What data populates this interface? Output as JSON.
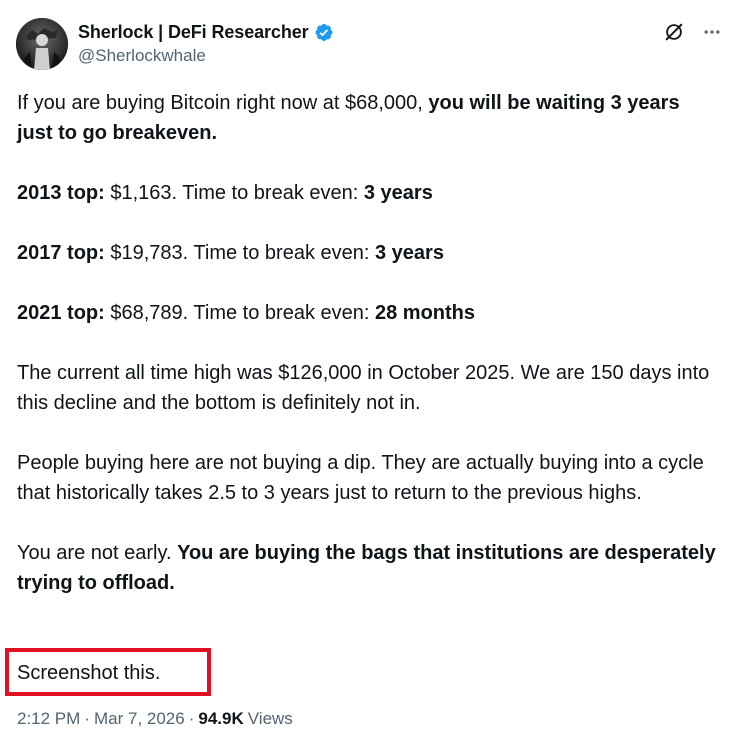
{
  "author": {
    "display_name": "Sherlock | DeFi Researcher",
    "handle": "@Sherlockwhale",
    "verified_color": "#1d9bf0"
  },
  "paragraphs": [
    {
      "runs": [
        {
          "text": "If you are buying Bitcoin right now at $68,000, ",
          "bold": false
        },
        {
          "text": "you will be waiting 3 years just to go breakeven.",
          "bold": true
        }
      ]
    },
    {
      "runs": [
        {
          "text": "2013 top:",
          "bold": true
        },
        {
          "text": " $1,163. Time to break even: ",
          "bold": false
        },
        {
          "text": "3 years",
          "bold": true
        }
      ]
    },
    {
      "runs": [
        {
          "text": "2017 top:",
          "bold": true
        },
        {
          "text": " $19,783. Time to break even: ",
          "bold": false
        },
        {
          "text": "3 years",
          "bold": true
        }
      ]
    },
    {
      "runs": [
        {
          "text": "2021 top:",
          "bold": true
        },
        {
          "text": " $68,789. Time to break even: ",
          "bold": false
        },
        {
          "text": "28 months",
          "bold": true
        }
      ]
    },
    {
      "runs": [
        {
          "text": "The current all time high was $126,000 in October 2025. We are 150 days into this decline and the bottom is definitely not in.",
          "bold": false
        }
      ]
    },
    {
      "runs": [
        {
          "text": "People buying here are not buying a dip. They are actually buying into a cycle that historically takes 2.5 to 3 years just to return to the previous highs.",
          "bold": false
        }
      ]
    },
    {
      "runs": [
        {
          "text": "You are not early. ",
          "bold": false
        },
        {
          "text": "You are buying the bags that institutions are desperately trying to offload.",
          "bold": true
        }
      ]
    }
  ],
  "final_line": "Screenshot this.",
  "highlight_color": "#e0101e",
  "meta": {
    "time": "2:12 PM",
    "separator": "·",
    "date": "Mar 7, 2026",
    "views_count": "94.9K",
    "views_label": "Views"
  },
  "icons": {
    "grok": "grok-icon",
    "more": "more-icon",
    "verified": "verified-badge-icon"
  }
}
